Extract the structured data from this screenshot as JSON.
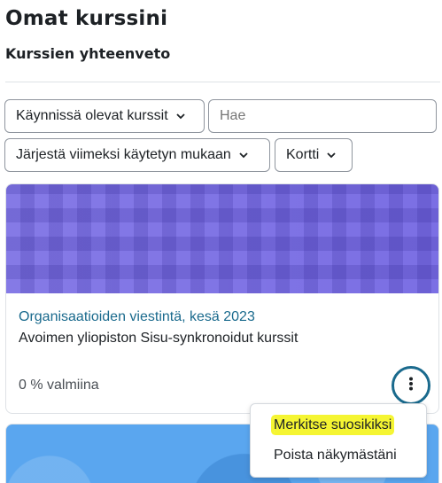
{
  "page": {
    "title": "Omat kurssini"
  },
  "overview": {
    "title": "Kurssien yhteenveto"
  },
  "controls": {
    "filter_label": "Käynnissä olevat kurssit",
    "search_placeholder": "Hae",
    "sort_label": "Järjestä viimeksi käytetyn mukaan",
    "view_label": "Kortti"
  },
  "course": {
    "category": "Organisaatioiden viestintä, kesä 2023",
    "name": "Avoimen yliopiston Sisu-synkronoidut kurssit",
    "progress_text": "0 % valmiina",
    "progress_percent": 0
  },
  "course_menu": {
    "items": [
      {
        "label": "Merkitse suosikiksi",
        "highlighted": true
      },
      {
        "label": "Poista näkymästäni",
        "highlighted": false
      }
    ]
  },
  "colors": {
    "link": "#1a6a8d",
    "course_image_1": "#7b6fe4",
    "course_image_2": "#5aa6ef",
    "highlight": "#f5f532"
  },
  "icons": {
    "dropdown": "chevron-down-icon",
    "course_menu": "vertical-ellipsis-icon"
  }
}
